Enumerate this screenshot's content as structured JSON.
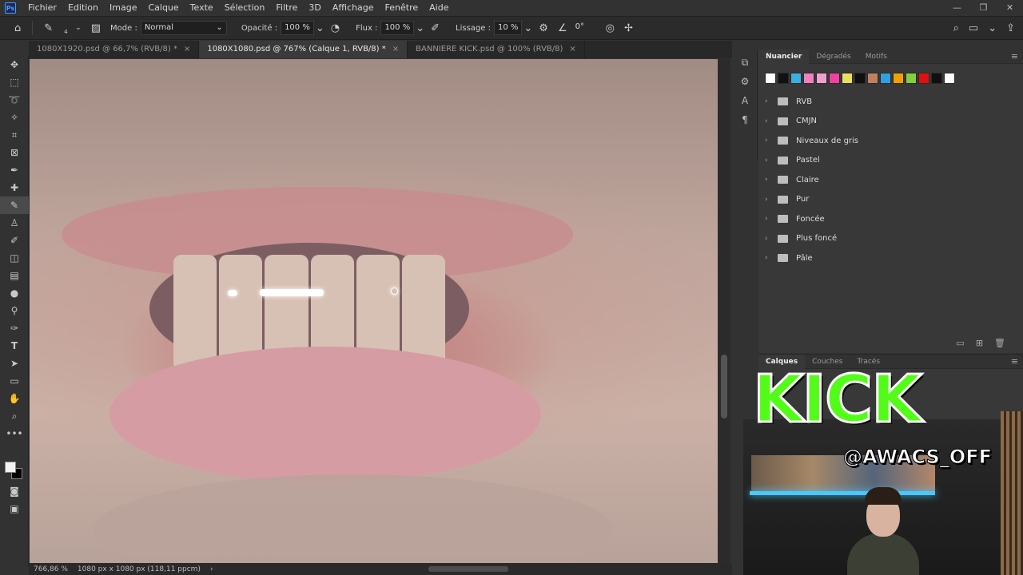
{
  "app": {
    "logo": "Ps"
  },
  "menu": [
    "Fichier",
    "Edition",
    "Image",
    "Calque",
    "Texte",
    "Sélection",
    "Filtre",
    "3D",
    "Affichage",
    "Fenêtre",
    "Aide"
  ],
  "options": {
    "mode_label": "Mode :",
    "mode_value": "Normal",
    "opacity_label": "Opacité :",
    "opacity_value": "100 %",
    "flow_label": "Flux :",
    "flow_value": "100 %",
    "smoothing_label": "Lissage :",
    "smoothing_value": "10 %",
    "angle_value": "0°",
    "brush_size": "4"
  },
  "tabs": [
    {
      "label": "1080X1920.psd @ 66,7% (RVB/8) *",
      "close": "×"
    },
    {
      "label": "1080X1080.psd @ 767% (Calque 1, RVB/8) *",
      "close": "×"
    },
    {
      "label": "BANNIERE KICK.psd @ 100% (RVB/8)",
      "close": "×"
    }
  ],
  "status": {
    "zoom": "766,86 %",
    "doc": "1080 px x 1080 px (118,11 ppcm)",
    "arrow": "›"
  },
  "swatches_panel": {
    "tabs": [
      "Nuancier",
      "Dégradés",
      "Motifs"
    ],
    "chips": [
      "#ffffff",
      "#111111",
      "#3ab0e0",
      "#f080c0",
      "#f0a0d0",
      "#f040a0",
      "#e8e060",
      "#101010",
      "#c08060",
      "#30a0e0",
      "#f0a000",
      "#80d040",
      "#e01010",
      "#101010",
      "#ffffff"
    ],
    "groups": [
      "RVB",
      "CMJN",
      "Niveaux de gris",
      "Pastel",
      "Claire",
      "Pur",
      "Foncée",
      "Plus foncé",
      "Pâle"
    ]
  },
  "layers_panel": {
    "tabs": [
      "Calques",
      "Couches",
      "Tracés"
    ]
  },
  "overlay": {
    "brand": "KICK",
    "handle": "@AWACS_OFF"
  },
  "colors": {
    "kick_green": "#53fc18",
    "accent_blue": "#31a8ff"
  }
}
